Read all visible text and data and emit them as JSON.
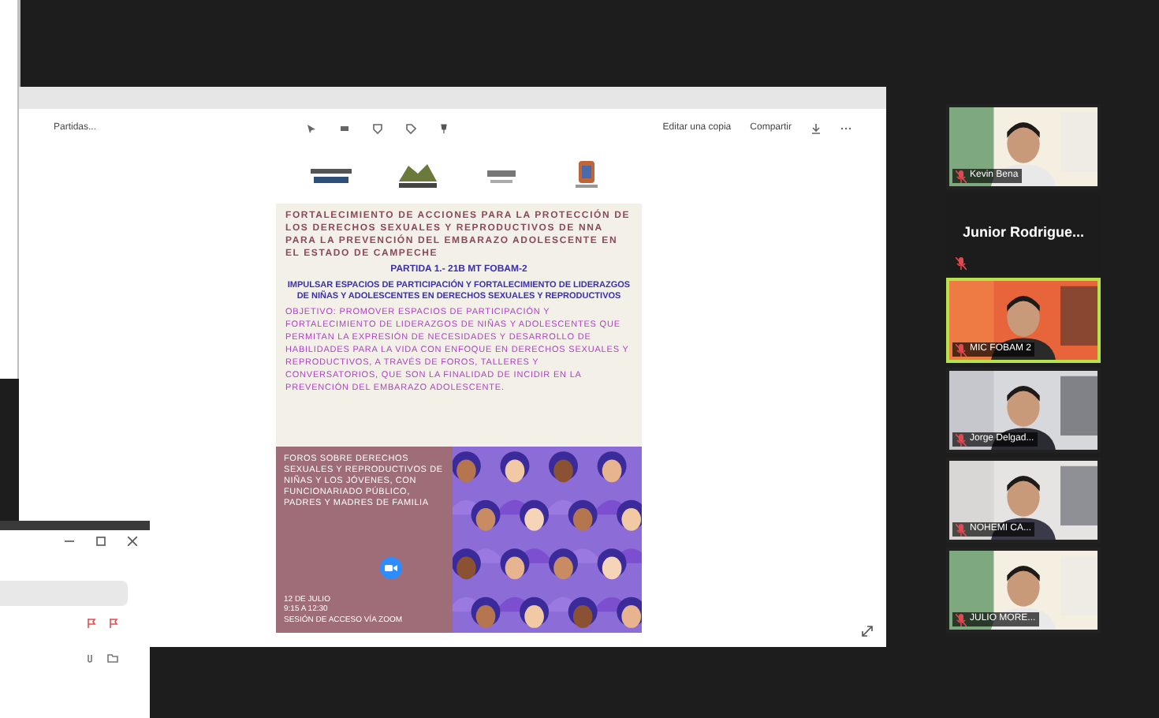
{
  "shared_screen": {
    "toolbar": {
      "document_name": "Partidas...",
      "edit_label": "Editar una copia",
      "share_label": "Compartir"
    },
    "document": {
      "title": "FORTALECIMIENTO DE ACCIONES PARA LA PROTECCIÓN DE LOS DERECHOS SEXUALES Y REPRODUCTIVOS DE NNA PARA LA PREVENCIÓN DEL EMBARAZO ADOLESCENTE EN EL ESTADO DE CAMPECHE",
      "partida": "PARTIDA 1.- 21B MT FOBAM-2",
      "heading": "IMPULSAR ESPACIOS DE PARTICIPACIÓN Y FORTALECIMIENTO DE LIDERAZGOS DE NIÑAS Y ADOLESCENTES EN DERECHOS SEXUALES Y REPRODUCTIVOS",
      "objective": "OBJETIVO: PROMOVER ESPACIOS DE PARTICIPACIÓN Y FORTALECIMIENTO DE LIDERAZGOS DE NIÑAS Y ADOLESCENTES QUE PERMITAN LA EXPRESIÓN DE NECESIDADES Y DESARROLLO DE HABILIDADES PARA LA VIDA CON ENFOQUE EN DERECHOS SEXUALES Y REPRODUCTIVOS, A TRAVÉS DE FOROS, TALLERES Y CONVERSATORIOS, QUE SON LA FINALIDAD DE INCIDIR EN LA PREVENCIÓN DEL EMBARAZO ADOLESCENTE.",
      "forum": "FOROS SOBRE DERECHOS SEXUALES Y REPRODUCTIVOS DE NIÑAS Y LOS JÓVENES, CON FUNCIONARIADO PÚBLICO, PADRES Y MADRES DE FAMILIA",
      "event_lines": [
        "12 DE JULIO",
        "9:15 A 12:30",
        "SESIÓN DE ACCESO VÍA ZOOM"
      ]
    }
  },
  "participants": [
    {
      "name": "Kevin Bena",
      "kind": "video",
      "selected": false
    },
    {
      "name": "Junior Rodrigue...",
      "kind": "name_only",
      "selected": false
    },
    {
      "name": "MIC FOBAM 2",
      "kind": "video",
      "selected": true
    },
    {
      "name": "Jorge Delgad...",
      "kind": "video",
      "selected": false
    },
    {
      "name": "NOHEMI CA...",
      "kind": "video",
      "selected": false
    },
    {
      "name": "JULIO MORE...",
      "kind": "video",
      "selected": false
    }
  ]
}
